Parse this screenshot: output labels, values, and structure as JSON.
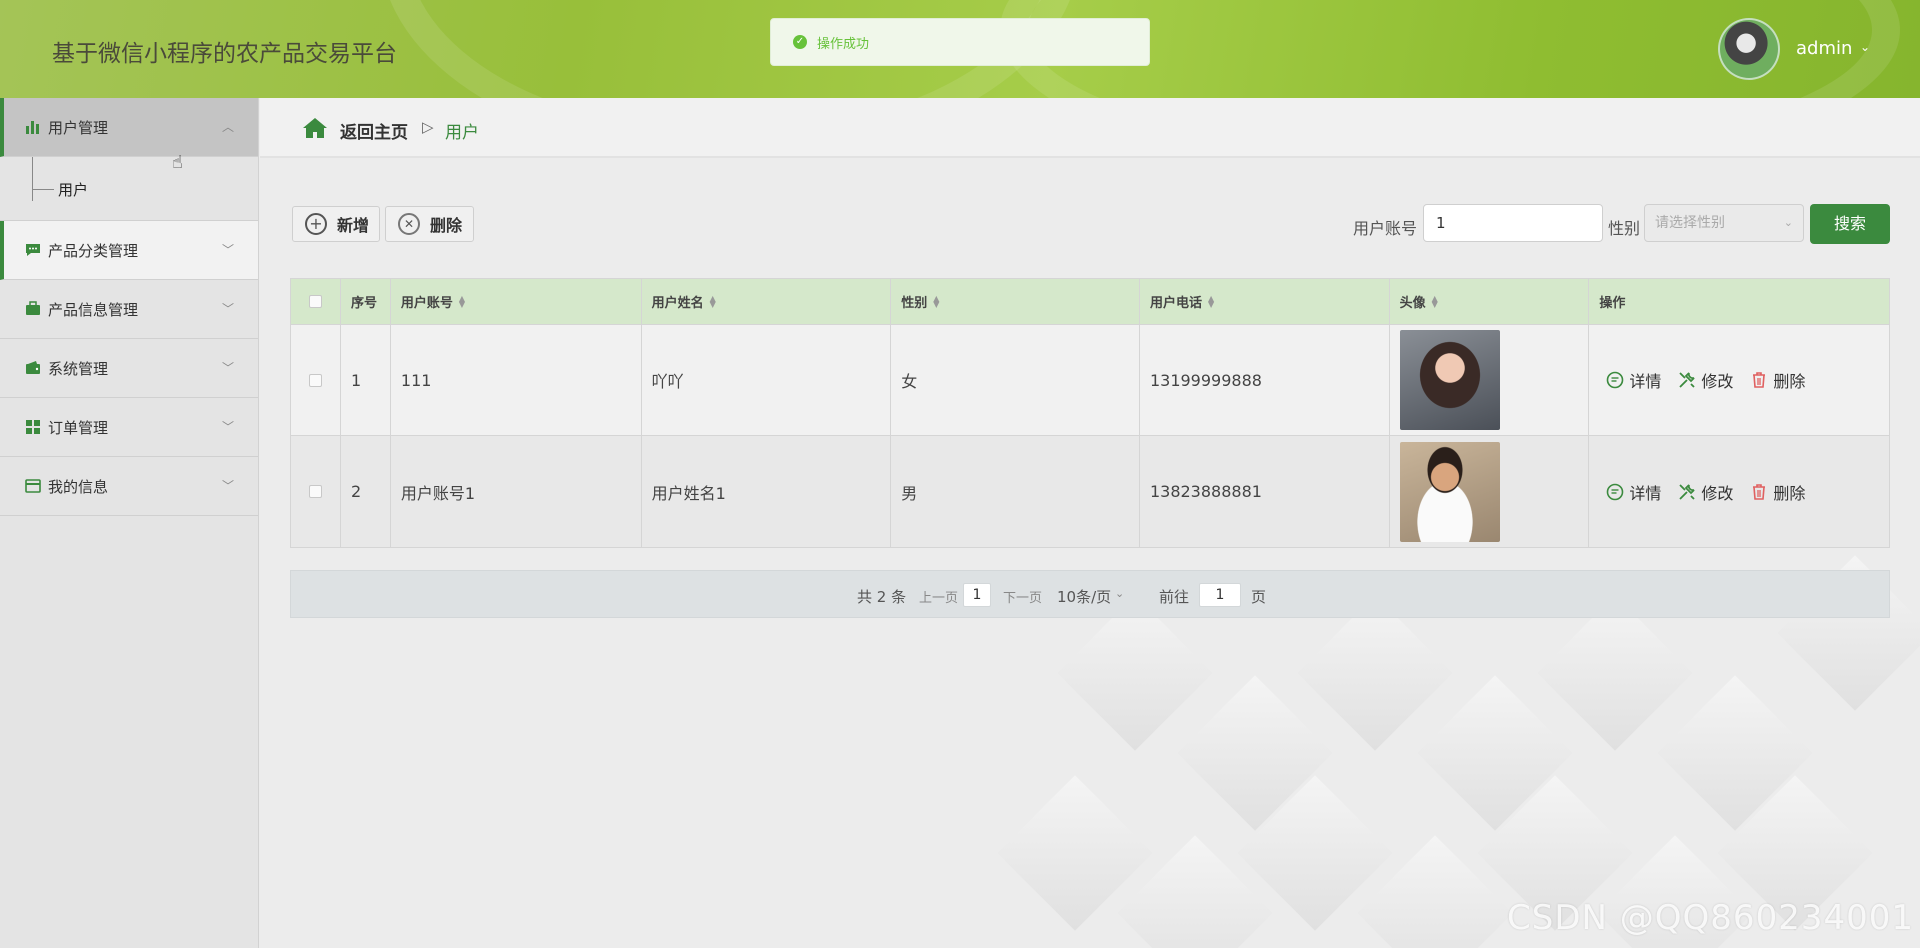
{
  "header": {
    "title": "基于微信小程序的农产品交易平台",
    "toast": "操作成功",
    "user_name": "admin"
  },
  "sidebar": {
    "items": [
      {
        "label": "用户管理",
        "icon": "bar-chart-icon",
        "expanded": true
      },
      {
        "label": "产品分类管理",
        "icon": "chat-icon"
      },
      {
        "label": "产品信息管理",
        "icon": "briefcase-icon"
      },
      {
        "label": "系统管理",
        "icon": "wallet-icon"
      },
      {
        "label": "订单管理",
        "icon": "grid-icon"
      },
      {
        "label": "我的信息",
        "icon": "card-icon"
      }
    ],
    "subitem": "用户"
  },
  "breadcrumb": {
    "home": "返回主页",
    "separator": "▷",
    "current": "用户"
  },
  "toolbar": {
    "add_label": "新增",
    "delete_label": "删除"
  },
  "search": {
    "account_label": "用户账号",
    "account_value": "1",
    "gender_label": "性别",
    "gender_placeholder": "请选择性别",
    "button_label": "搜索"
  },
  "table": {
    "columns": [
      "序号",
      "用户账号",
      "用户姓名",
      "性别",
      "用户电话",
      "头像",
      "操作"
    ],
    "rows": [
      {
        "index": "1",
        "account": "111",
        "name": "吖吖",
        "gender": "女",
        "phone": "13199999888"
      },
      {
        "index": "2",
        "account": "用户账号1",
        "name": "用户姓名1",
        "gender": "男",
        "phone": "13823888881"
      }
    ],
    "actions": {
      "detail": "详情",
      "edit": "修改",
      "delete": "删除"
    }
  },
  "pagination": {
    "total": "共 2 条",
    "prev": "上一页",
    "current_page": "1",
    "next": "下一页",
    "page_size": "10条/页",
    "goto_label": "前往",
    "goto_value": "1",
    "page_suffix": "页"
  },
  "watermark": "CSDN @QQ860234001",
  "colors": {
    "accent": "#3b8a3e",
    "header_green": "#98bf3a",
    "table_header": "#d5e8cb",
    "delete_red": "#e06060"
  }
}
